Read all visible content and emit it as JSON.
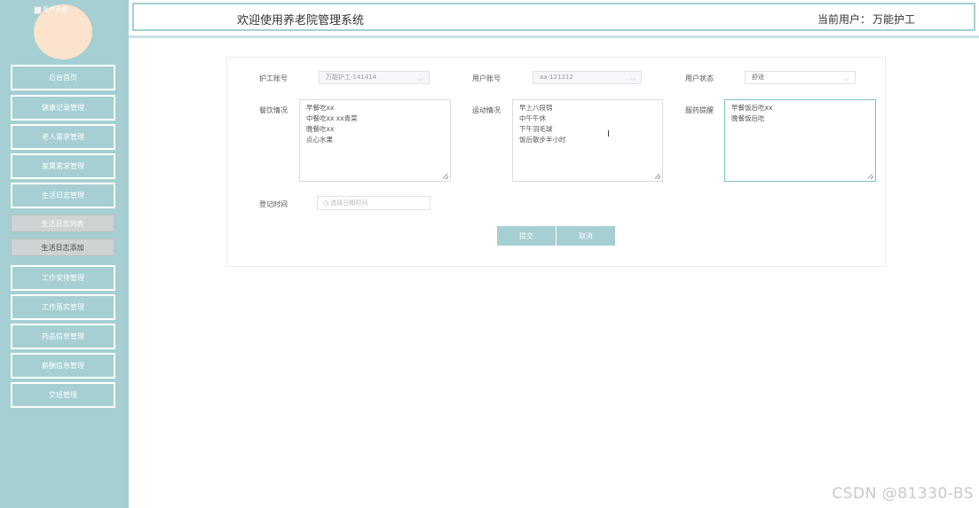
{
  "sidebar": {
    "avatar_alt": "用户头像",
    "items": [
      {
        "label": "后台首页"
      },
      {
        "label": "健康记录管理"
      },
      {
        "label": "老人需求管理"
      },
      {
        "label": "家属需求管理"
      },
      {
        "label": "生活日志管理"
      }
    ],
    "sub_items": [
      {
        "label": "生活日志列表"
      },
      {
        "label": "生活日志添加"
      }
    ],
    "items2": [
      {
        "label": "工作安排管理"
      },
      {
        "label": "工作落实管理"
      },
      {
        "label": "药品信息管理"
      },
      {
        "label": "薪酬信息管理"
      },
      {
        "label": "交班管理"
      }
    ]
  },
  "header": {
    "title": "欢迎使用养老院管理系统",
    "current_user_label": "当前用户：",
    "current_user": "万能护工"
  },
  "form": {
    "nurse_account_label": "护工账号",
    "nurse_account_value": "万能护工-141414",
    "user_account_label": "用户账号",
    "user_account_value": "aa-121212",
    "user_status_label": "用户状态",
    "user_status_value": "舒适",
    "diet_label": "餐饮情况",
    "diet_lines": [
      "早餐吃xx",
      "中餐吃xx  xx青菜",
      "晚餐吃xx",
      "点心水果"
    ],
    "exercise_label": "运动情况",
    "exercise_lines": [
      "早上八段锦",
      "中午午休",
      "下午羽毛球",
      "饭后散步半小时"
    ],
    "medication_label": "服药提醒",
    "medication_lines": [
      "早餐饭后吃xx",
      "晚餐饭后吃"
    ],
    "register_time_label": "登记时间",
    "register_time_placeholder": "选择日期时间",
    "submit_label": "提交",
    "cancel_label": "取消"
  },
  "watermark": "CSDN @81330-BS",
  "colors": {
    "accent": "#a5cfd3",
    "avatar": "#fbe3cd"
  }
}
